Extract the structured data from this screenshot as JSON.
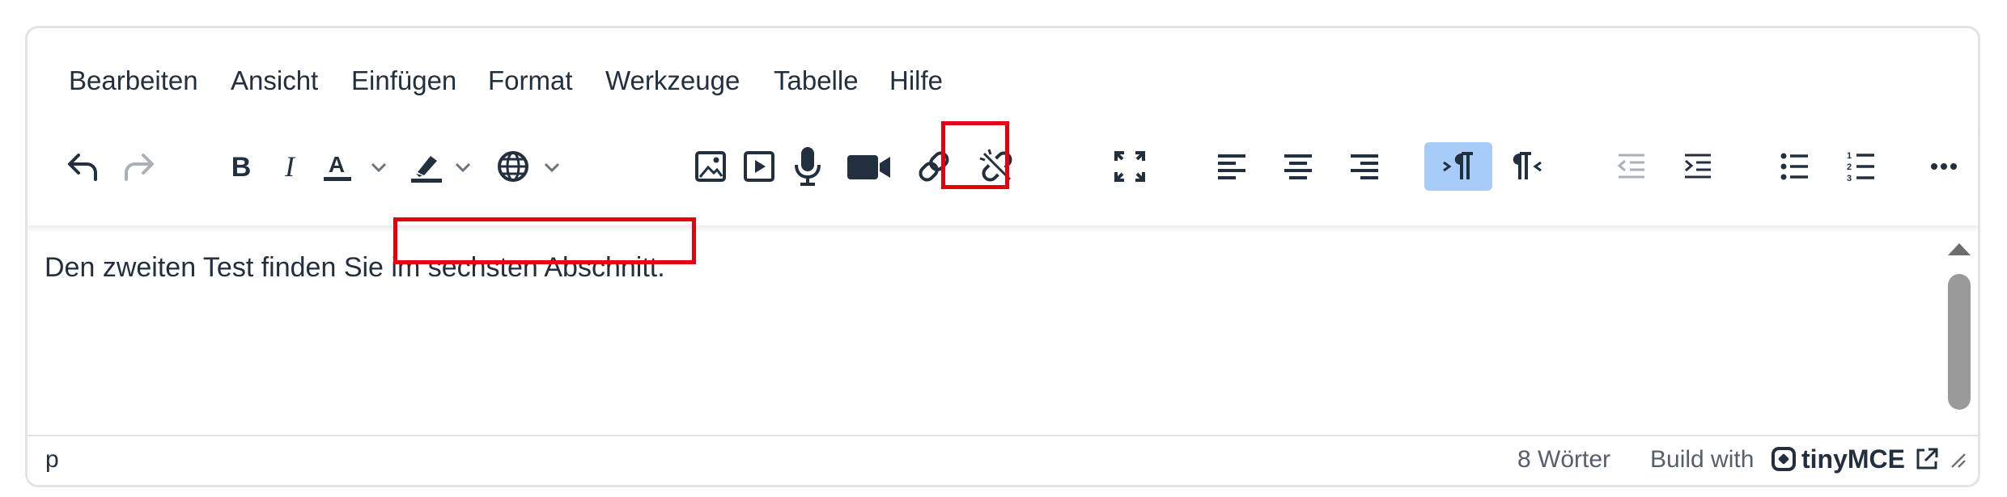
{
  "menubar": {
    "items": [
      {
        "label": "Bearbeiten"
      },
      {
        "label": "Ansicht"
      },
      {
        "label": "Einfügen"
      },
      {
        "label": "Format"
      },
      {
        "label": "Werkzeuge"
      },
      {
        "label": "Tabelle"
      },
      {
        "label": "Hilfe"
      }
    ]
  },
  "toolbar": {
    "buttons": [
      {
        "icon": "undo-icon"
      },
      {
        "icon": "redo-icon",
        "state": "disabled"
      },
      {
        "icon": "bold-icon"
      },
      {
        "icon": "italic-icon"
      },
      {
        "icon": "text-color-icon"
      },
      {
        "icon": "highlight-color-icon"
      },
      {
        "icon": "language-icon"
      },
      {
        "icon": "image-icon"
      },
      {
        "icon": "media-icon"
      },
      {
        "icon": "microphone-icon"
      },
      {
        "icon": "video-camera-icon"
      },
      {
        "icon": "link-icon"
      },
      {
        "icon": "unlink-icon"
      },
      {
        "icon": "fullscreen-icon"
      },
      {
        "icon": "align-left-icon"
      },
      {
        "icon": "align-center-icon"
      },
      {
        "icon": "align-right-icon"
      },
      {
        "icon": "ltr-icon",
        "state": "active"
      },
      {
        "icon": "rtl-icon"
      },
      {
        "icon": "outdent-icon",
        "state": "disabled"
      },
      {
        "icon": "indent-icon"
      },
      {
        "icon": "bullet-list-icon"
      },
      {
        "icon": "numbered-list-icon"
      },
      {
        "icon": "more-icon"
      }
    ]
  },
  "content": {
    "text_before": "Den zweiten Test finden Sie ",
    "text_selected": "im sechsten Abschnitt."
  },
  "statusbar": {
    "path": "p",
    "word_count": "8 Wörter",
    "build_with": "Build with",
    "brand": "tinyMCE"
  },
  "colors": {
    "highlight_border": "#e3000f",
    "active_button": "#a6ccf7",
    "text": "#222f3e"
  }
}
